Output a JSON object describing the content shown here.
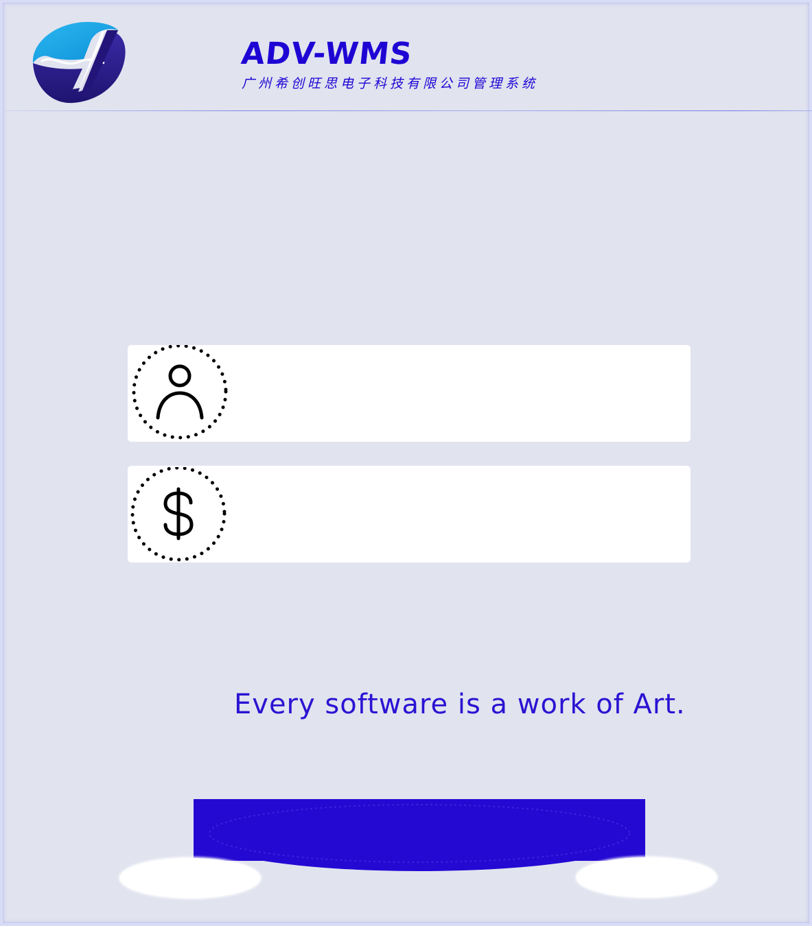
{
  "header": {
    "logo_icon": "adv-wms-logo-icon",
    "title": "ADV-WMS",
    "subtitle": "广州希创旺思电子科技有限公司管理系统"
  },
  "login_form": {
    "username_field": {
      "icon": "user-icon",
      "value": "",
      "placeholder": ""
    },
    "password_field": {
      "icon": "dollar-icon",
      "value": "",
      "placeholder": ""
    },
    "login_button_label": ""
  },
  "motto": "Every software is a work of Art.",
  "colors": {
    "background": "#e1e3ef",
    "accent": "#2409d3",
    "field_background": "#ffffff",
    "logo_light_blue": "#16a4e6",
    "logo_dark_blue": "#261b8c"
  }
}
